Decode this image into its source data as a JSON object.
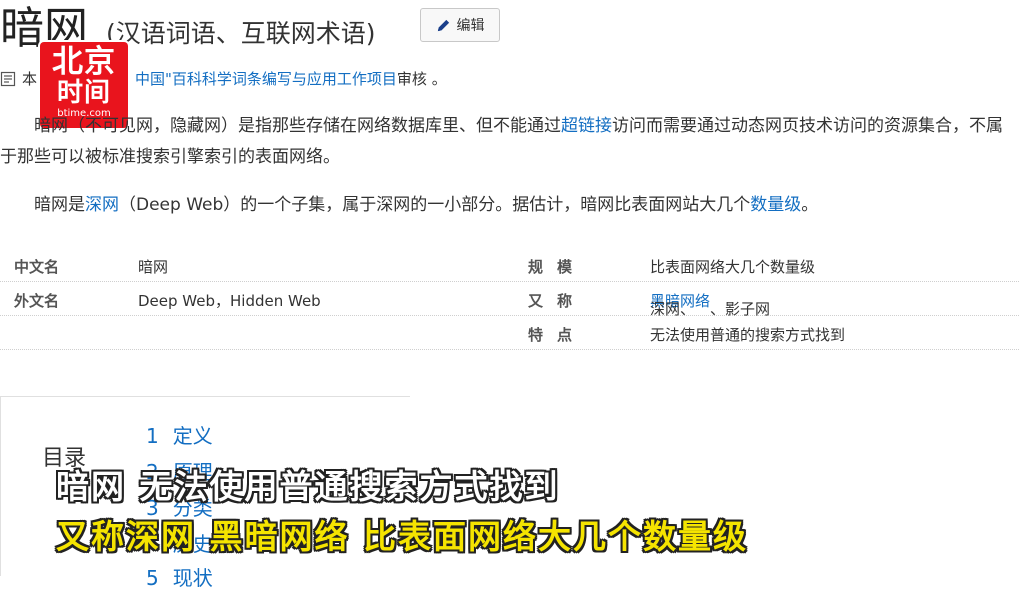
{
  "page": {
    "title": "暗网",
    "subtitle": "(汉语词语、互联网术语)",
    "edit_label": "编辑"
  },
  "review": {
    "prefix": "本",
    "link": "中国\"百科科学词条编写与应用工作项目",
    "suffix": " 审核 。"
  },
  "logo": {
    "line1": "北京",
    "line2": "时间",
    "line3": "btime.com"
  },
  "paragraph1": {
    "text_a": "暗网（不可见网，隐藏网）是指那些存储在网络数据库里、但不能通过",
    "link": "超链接",
    "text_b": "访问而需要通过动态网页技术访问的资源集合，不属于那些可以被标准搜索引擎索引的表面网络。"
  },
  "paragraph2": {
    "text_a": "暗网是",
    "link1": "深网",
    "text_b": "（Deep Web）的一个子集，属于深网的一小部分。据估计，暗网比表面网站大几个",
    "link2": "数量级",
    "text_c": "。"
  },
  "info_table": {
    "rows": [
      {
        "k1": "中文名",
        "v1": "暗网",
        "k2": "规模",
        "v2": "比表面网络大几个数量级"
      },
      {
        "k1": "外文名",
        "v1": "Deep Web，Hidden Web",
        "k2": "又称",
        "v2a": "深网、",
        "v2link": "黑暗网络",
        "v2b": "、影子网"
      },
      {
        "k1": "",
        "v1": "",
        "k2": "特点",
        "v2": "无法使用普通的搜索方式找到"
      }
    ]
  },
  "toc": {
    "title": "目录",
    "items": [
      {
        "num": "1",
        "label": "定义"
      },
      {
        "num": "2",
        "label": "原理"
      },
      {
        "num": "3",
        "label": "分类"
      },
      {
        "num": "4",
        "label": "历史"
      },
      {
        "num": "5",
        "label": "现状"
      }
    ]
  },
  "captions": {
    "line1": "暗网 无法使用普通搜索方式找到",
    "line2": "又称深网 黑暗网络 比表面网络大几个数量级"
  },
  "colors": {
    "link": "#136ec2",
    "logo_red": "#e9141d",
    "caption_yellow": "#f5e400"
  }
}
